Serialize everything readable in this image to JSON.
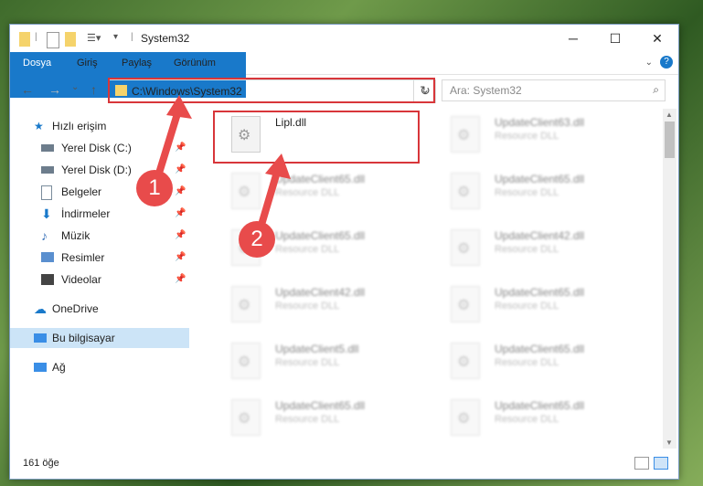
{
  "window": {
    "title": "System32",
    "controls": {
      "minimize": "─",
      "maximize": "☐",
      "close": "✕"
    }
  },
  "ribbon": {
    "tabs": [
      "Dosya",
      "Giriş",
      "Paylaş",
      "Görünüm"
    ],
    "help": "?"
  },
  "nav": {
    "back": "←",
    "forward": "→",
    "up": "↑",
    "address": "C:\\Windows\\System32",
    "refresh": "↻",
    "search_placeholder": "Ara: System32"
  },
  "sidebar": {
    "quick_access": "Hızlı erişim",
    "items": [
      {
        "label": "Yerel Disk (C:)",
        "icon": "disk-icon",
        "pinned": true
      },
      {
        "label": "Yerel Disk (D:)",
        "icon": "disk-icon",
        "pinned": true
      },
      {
        "label": "Belgeler",
        "icon": "documents-icon",
        "pinned": true
      },
      {
        "label": "İndirmeler",
        "icon": "downloads-icon",
        "pinned": true
      },
      {
        "label": "Müzik",
        "icon": "music-icon",
        "pinned": true
      },
      {
        "label": "Resimler",
        "icon": "pictures-icon",
        "pinned": true
      },
      {
        "label": "Videolar",
        "icon": "videos-icon",
        "pinned": true
      }
    ],
    "onedrive": "OneDrive",
    "this_pc": "Bu bilgisayar",
    "network": "Ağ"
  },
  "files": [
    {
      "name": "Lipl.dll",
      "type": "",
      "highlighted": true
    },
    {
      "name": "UpdateClient63.dll",
      "type": "Resource DLL"
    },
    {
      "name": "UpdateClient65.dll",
      "type": "Resource DLL"
    },
    {
      "name": "UpdateClient65.dll",
      "type": "Resource DLL"
    },
    {
      "name": "UpdateClient65.dll",
      "type": "Resource DLL"
    },
    {
      "name": "UpdateClient42.dll",
      "type": "Resource DLL"
    },
    {
      "name": "UpdateClient42.dll",
      "type": "Resource DLL"
    },
    {
      "name": "UpdateClient65.dll",
      "type": "Resource DLL"
    },
    {
      "name": "UpdateClient5.dll",
      "type": "Resource DLL"
    },
    {
      "name": "UpdateClient65.dll",
      "type": "Resource DLL"
    },
    {
      "name": "UpdateClient65.dll",
      "type": "Resource DLL"
    },
    {
      "name": "UpdateClient65.dll",
      "type": "Resource DLL"
    }
  ],
  "status": {
    "count": "161 öğe"
  },
  "callouts": {
    "one": "1",
    "two": "2"
  }
}
